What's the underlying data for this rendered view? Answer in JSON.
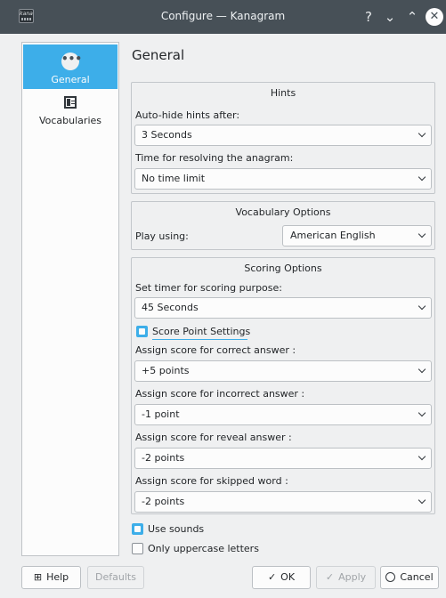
{
  "window": {
    "title": "Configure — Kanagram",
    "app_icon_text": "kana",
    "help_glyph": "?",
    "minimize_glyph": "⌄",
    "maximize_glyph": "⌃",
    "close_glyph": "✕"
  },
  "sidebar": {
    "items": [
      {
        "label": "General",
        "icon": "more-dots-icon",
        "glyph": "•••",
        "active": true
      },
      {
        "label": "Vocabularies",
        "icon": "vocabulary-list-icon",
        "active": false
      }
    ]
  },
  "page": {
    "title": "General"
  },
  "hints": {
    "title": "Hints",
    "autohide_label": "Auto-hide hints after:",
    "autohide_value": "3 Seconds",
    "resolve_label": "Time for resolving the anagram:",
    "resolve_value": "No time limit"
  },
  "vocabulary": {
    "title": "Vocabulary Options",
    "play_using_label": "Play using:",
    "play_using_value": "American English"
  },
  "scoring": {
    "title": "Scoring Options",
    "timer_label": "Set timer for scoring purpose:",
    "timer_value": "45 Seconds",
    "score_point_settings_label": "Score Point Settings",
    "score_point_settings_checked": true,
    "correct_label": "Assign score for correct answer :",
    "correct_value": "+5 points",
    "incorrect_label": "Assign score for incorrect answer :",
    "incorrect_value": "-1 point",
    "reveal_label": "Assign score for reveal answer :",
    "reveal_value": "-2 points",
    "skipped_label": "Assign score for skipped word :",
    "skipped_value": "-2 points"
  },
  "options": {
    "use_sounds_label": "Use sounds",
    "use_sounds_checked": true,
    "uppercase_label": "Only uppercase letters",
    "uppercase_checked": false
  },
  "buttons": {
    "help": "Help",
    "help_icon": "⊞",
    "defaults": "Defaults",
    "ok": "OK",
    "ok_icon": "✓",
    "apply": "Apply",
    "apply_icon": "✓",
    "cancel": "Cancel",
    "cancel_icon": "⃠"
  },
  "colors": {
    "accent": "#3daee9",
    "titlebar": "#475057",
    "background": "#eff0f1"
  }
}
